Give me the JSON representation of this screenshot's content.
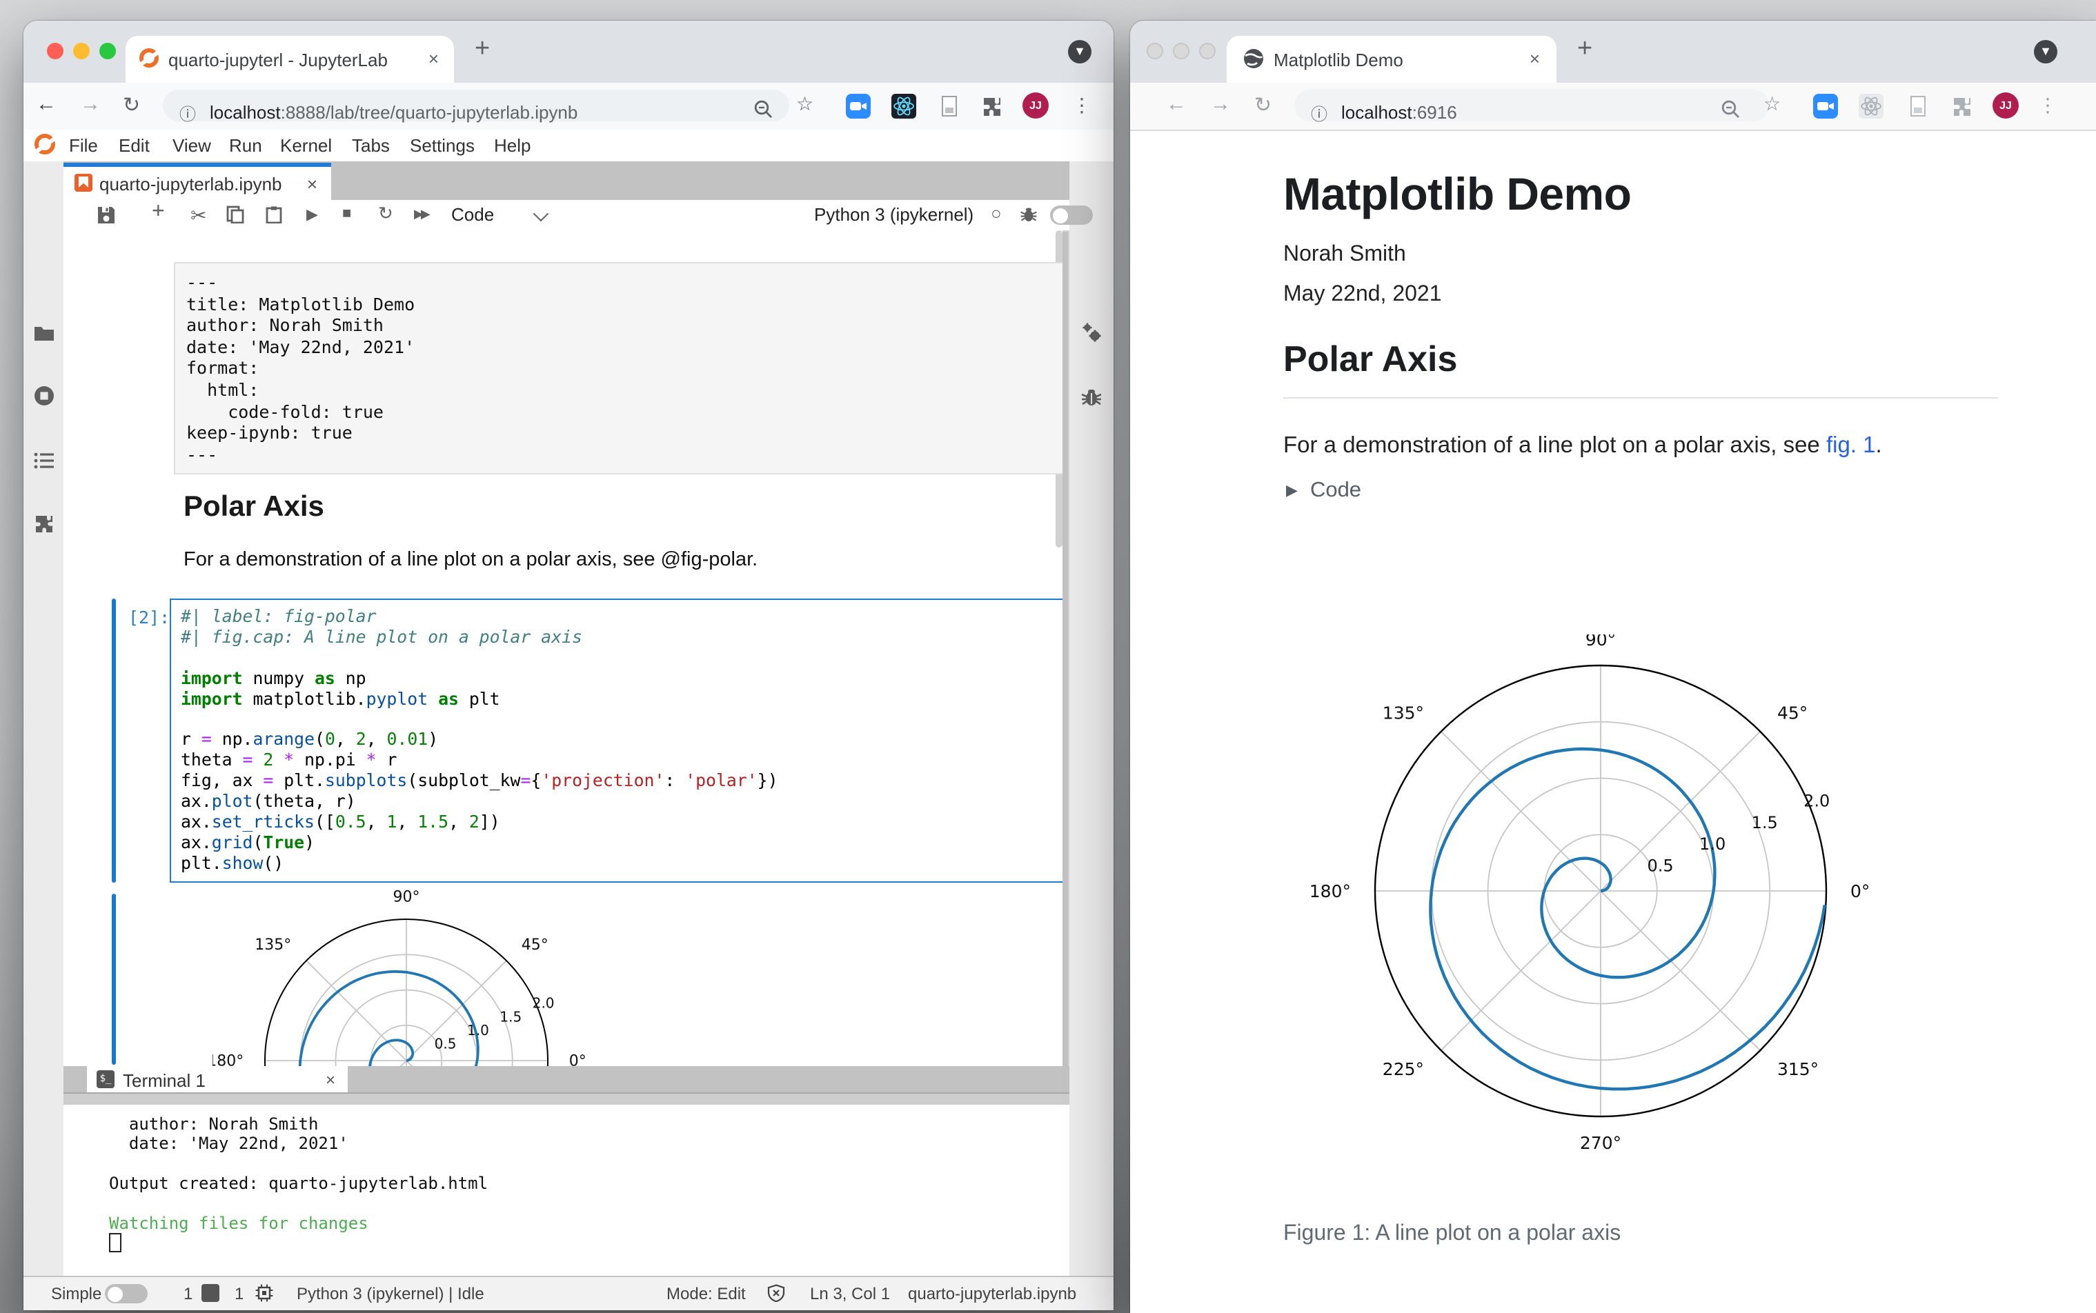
{
  "colors": {
    "accent_blue": "#1e7bd6",
    "quarto_orange": "#ee6f27",
    "link_blue": "#2761e3",
    "plot_line": "#1f77b4",
    "terminal_green": "#4caf50",
    "prompt_blue": "#307fc1"
  },
  "left_window": {
    "browser": {
      "tab_title": "quarto-jupyterl - JupyterLab",
      "url_host": "localhost",
      "url_rest": ":8888/lab/tree/quarto-jupyterlab.ipynb",
      "avatar_initials": "JJ"
    },
    "menubar": {
      "items": [
        "File",
        "Edit",
        "View",
        "Run",
        "Kernel",
        "Tabs",
        "Settings",
        "Help"
      ]
    },
    "doc_tab_title": "quarto-jupyterlab.ipynb",
    "nb_toolbar": {
      "cell_type": "Code",
      "kernel_name": "Python 3 (ipykernel)"
    },
    "yaml_cell_lines": [
      "---",
      "title: Matplotlib Demo",
      "author: Norah Smith",
      "date: 'May 22nd, 2021'",
      "format:",
      "  html:",
      "    code-fold: true",
      "keep-ipynb: true",
      "---"
    ],
    "markdown": {
      "heading": "Polar Axis",
      "paragraph": "For a demonstration of a line plot on a polar axis, see @fig-polar."
    },
    "code_cell": {
      "prompt": "[2]:",
      "lines": [
        [
          [
            "c",
            "#| label: fig-polar"
          ]
        ],
        [
          [
            "c",
            "#| fig.cap: A line plot on a polar axis"
          ]
        ],
        [],
        [
          [
            "k",
            "import"
          ],
          [
            "p",
            " numpy "
          ],
          [
            "k",
            "as"
          ],
          [
            "p",
            " np"
          ]
        ],
        [
          [
            "k",
            "import"
          ],
          [
            "p",
            " matplotlib."
          ],
          [
            "f",
            "pyplot"
          ],
          [
            "p",
            " "
          ],
          [
            "k",
            "as"
          ],
          [
            "p",
            " plt"
          ]
        ],
        [],
        [
          [
            "p",
            "r "
          ],
          [
            "o",
            "="
          ],
          [
            "p",
            " np."
          ],
          [
            "f",
            "arange"
          ],
          [
            "p",
            "("
          ],
          [
            "n",
            "0"
          ],
          [
            "p",
            ", "
          ],
          [
            "n",
            "2"
          ],
          [
            "p",
            ", "
          ],
          [
            "n",
            "0.01"
          ],
          [
            "p",
            ")"
          ]
        ],
        [
          [
            "p",
            "theta "
          ],
          [
            "o",
            "="
          ],
          [
            "p",
            " "
          ],
          [
            "n",
            "2"
          ],
          [
            "p",
            " "
          ],
          [
            "o",
            "*"
          ],
          [
            "p",
            " np.pi "
          ],
          [
            "o",
            "*"
          ],
          [
            "p",
            " r"
          ]
        ],
        [
          [
            "p",
            "fig, ax "
          ],
          [
            "o",
            "="
          ],
          [
            "p",
            " plt."
          ],
          [
            "f",
            "subplots"
          ],
          [
            "p",
            "(subplot_kw"
          ],
          [
            "o",
            "="
          ],
          [
            "p",
            "{"
          ],
          [
            "s",
            "'projection'"
          ],
          [
            "p",
            ": "
          ],
          [
            "s",
            "'polar'"
          ],
          [
            "p",
            "})"
          ]
        ],
        [
          [
            "p",
            "ax."
          ],
          [
            "f",
            "plot"
          ],
          [
            "p",
            "(theta, r)"
          ]
        ],
        [
          [
            "p",
            "ax."
          ],
          [
            "f",
            "set_rticks"
          ],
          [
            "p",
            "(["
          ],
          [
            "n",
            "0.5"
          ],
          [
            "p",
            ", "
          ],
          [
            "n",
            "1"
          ],
          [
            "p",
            ", "
          ],
          [
            "n",
            "1.5"
          ],
          [
            "p",
            ", "
          ],
          [
            "n",
            "2"
          ],
          [
            "p",
            "])"
          ]
        ],
        [
          [
            "p",
            "ax."
          ],
          [
            "f",
            "grid"
          ],
          [
            "p",
            "("
          ],
          [
            "k",
            "True"
          ],
          [
            "p",
            ")"
          ]
        ],
        [
          [
            "p",
            "plt."
          ],
          [
            "f",
            "show"
          ],
          [
            "p",
            "()"
          ]
        ]
      ]
    },
    "terminal": {
      "tab_title": "Terminal 1",
      "lines": [
        {
          "text": "  author: Norah Smith",
          "green": false
        },
        {
          "text": "  date: 'May 22nd, 2021'",
          "green": false
        },
        {
          "text": "",
          "green": false
        },
        {
          "text": "Output created: quarto-jupyterlab.html",
          "green": false
        },
        {
          "text": "",
          "green": false
        },
        {
          "text": "Watching files for changes",
          "green": true
        }
      ]
    },
    "statusbar": {
      "simple_label": "Simple",
      "terminals_count": "1",
      "kernels_count": "1",
      "kernel_status": "Python 3 (ipykernel) | Idle",
      "mode": "Mode: Edit",
      "cursor_position": "Ln 3, Col 1",
      "filename": "quarto-jupyterlab.ipynb"
    }
  },
  "right_window": {
    "browser": {
      "tab_title": "Matplotlib Demo",
      "url_host": "localhost",
      "url_rest": ":6916",
      "avatar_initials": "JJ"
    },
    "page": {
      "title": "Matplotlib Demo",
      "author": "Norah Smith",
      "date": "May 22nd, 2021",
      "section_heading": "Polar Axis",
      "para_before_link": "For a demonstration of a line plot on a polar axis, see ",
      "link_text": "fig. 1",
      "para_after_link": ".",
      "code_fold_label": "Code",
      "figure_caption": "Figure 1: A line plot on a polar axis"
    }
  },
  "chart_data": {
    "type": "line",
    "projection": "polar",
    "series": [
      {
        "name": "ax.plot(theta, r)",
        "r_start": 0,
        "r_end": 2,
        "r_step": 0.01,
        "theta_formula": "theta = 2*pi*r",
        "color": "#1f77b4"
      }
    ],
    "r_max": 2,
    "r_ticks": [
      0.5,
      1,
      1.5,
      2
    ],
    "r_tick_labels": [
      "0.5",
      "1.0",
      "1.5",
      "2.0"
    ],
    "r_label_angle_deg": 22.5,
    "theta_tick_labels": [
      "0°",
      "45°",
      "90°",
      "135°",
      "180°",
      "225°",
      "270°",
      "315°"
    ],
    "grid": true,
    "legend": false
  }
}
